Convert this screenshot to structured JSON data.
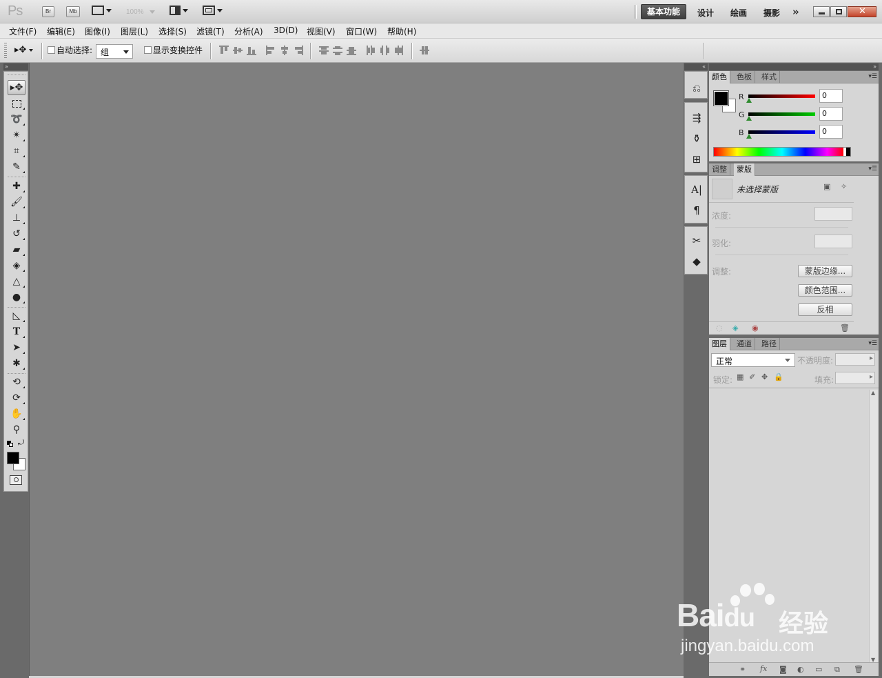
{
  "app": {
    "logo": "Ps",
    "bridge_btn": "Br",
    "minibridge_btn": "Mb",
    "zoom_level": "100%",
    "workspaces": [
      "基本功能",
      "设计",
      "绘画",
      "摄影"
    ],
    "more": "»"
  },
  "menu": [
    "文件(F)",
    "编辑(E)",
    "图像(I)",
    "图层(L)",
    "选择(S)",
    "滤镜(T)",
    "分析(A)",
    "3D(D)",
    "视图(V)",
    "窗口(W)",
    "帮助(H)"
  ],
  "options": {
    "auto_select_label": "自动选择:",
    "auto_select_value": "组",
    "show_transform_label": "显示变换控件"
  },
  "tools": {
    "collapse_glyph": "»"
  },
  "color_panel": {
    "tabs": [
      "颜色",
      "色板",
      "样式"
    ],
    "channels": [
      {
        "label": "R",
        "value": "0",
        "color": "#d40000"
      },
      {
        "label": "G",
        "value": "0",
        "color": "#00c000"
      },
      {
        "label": "B",
        "value": "0",
        "color": "#0000d8"
      }
    ],
    "foreground": "#000000",
    "background": "#ffffff"
  },
  "mask_panel": {
    "tabs": [
      "调整",
      "蒙版"
    ],
    "title": "未选择蒙版",
    "density_label": "浓度:",
    "feather_label": "羽化:",
    "refine_label": "调整:",
    "buttons": [
      "蒙版边缘...",
      "颜色范围...",
      "反相"
    ]
  },
  "layers_panel": {
    "tabs": [
      "图层",
      "通道",
      "路径"
    ],
    "blend_mode": "正常",
    "opacity_label": "不透明度:",
    "lock_label": "锁定:",
    "fill_label": "填充:"
  },
  "watermark": {
    "brand": "Bai",
    "brand2": "du",
    "cn": "经验",
    "url": "jingyan.baidu.com"
  }
}
